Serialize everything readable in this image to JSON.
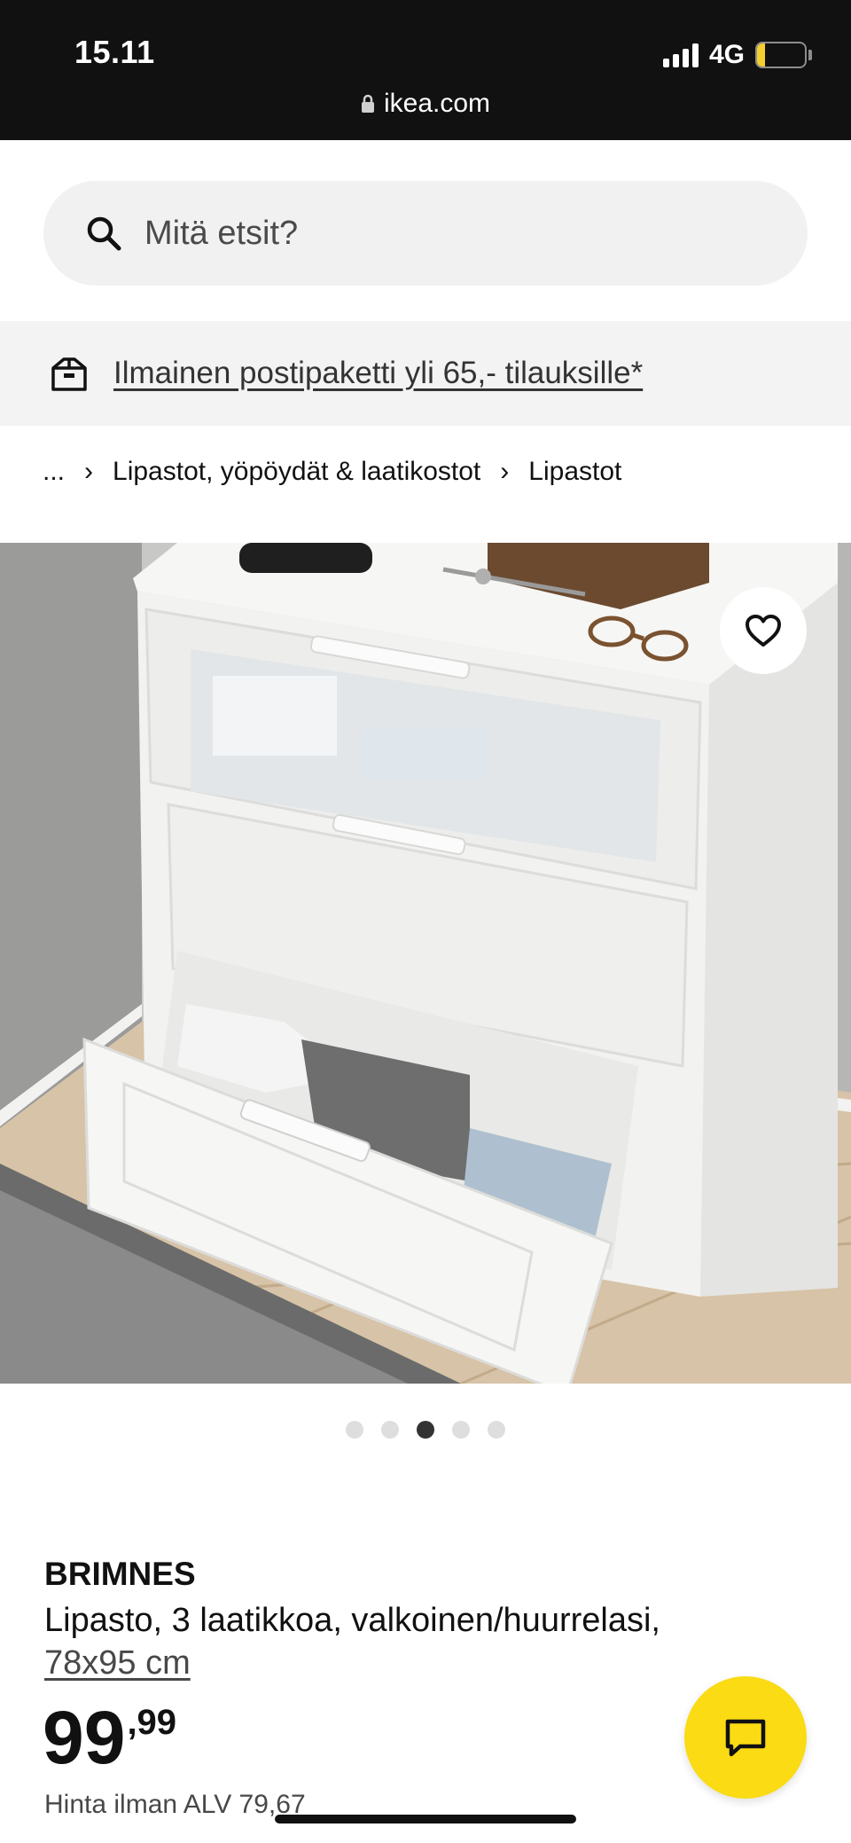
{
  "status_bar": {
    "time": "15.11",
    "network": "4G",
    "battery": "17",
    "battery_level": 0.17,
    "url": "ikea.com"
  },
  "search": {
    "placeholder": "Mitä etsit?"
  },
  "promo": {
    "text": "Ilmainen postipaketti yli 65,- tilauksille*"
  },
  "breadcrumb": {
    "ellipsis": "...",
    "items": [
      "Lipastot, yöpöydät & laatikostot",
      "Lipastot"
    ]
  },
  "gallery": {
    "total": 5,
    "active": 3
  },
  "product": {
    "name": "BRIMNES",
    "description": "Lipasto, 3 laatikkoa, valkoinen/huurrelasi,",
    "size": "78x95 cm",
    "price_int": "99",
    "price_dec": ",99",
    "vat_text": "Hinta ilman ALV 79,67"
  },
  "icons": {
    "search": "search-icon",
    "delivery": "parcel-icon",
    "favourite": "heart-icon",
    "chat": "chat-icon",
    "lock": "lock-icon"
  },
  "colors": {
    "accent_yellow": "#fadb14",
    "status_bar": "#111111",
    "panel_gray": "#f3f3f3"
  }
}
